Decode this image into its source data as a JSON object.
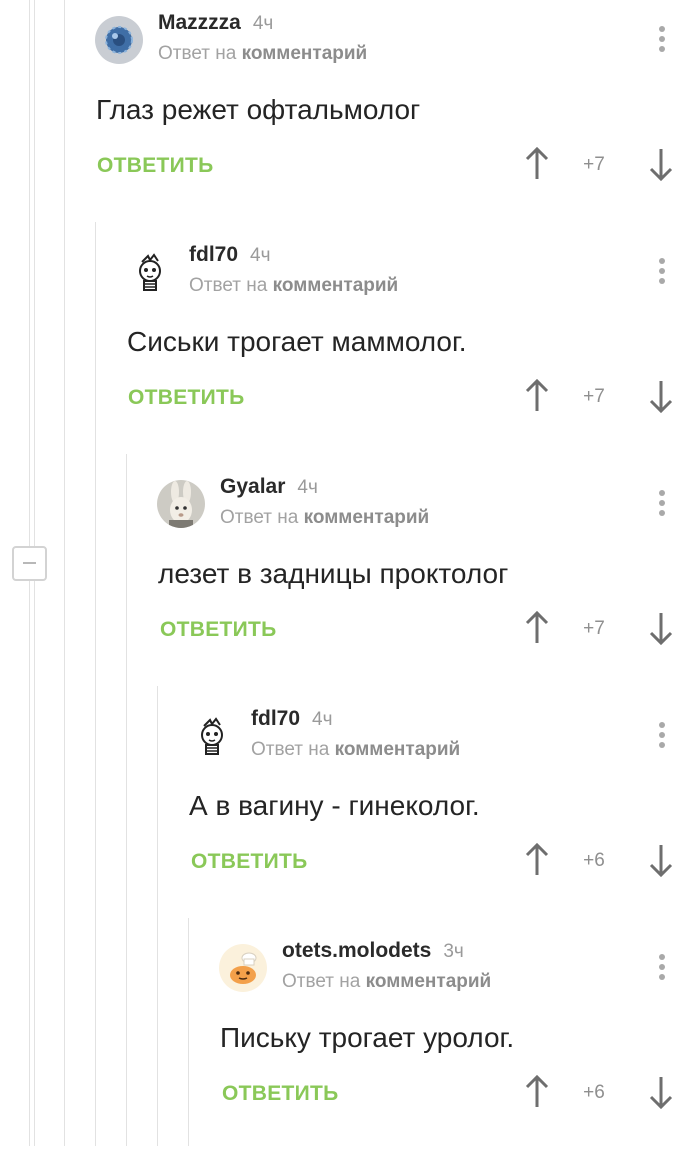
{
  "ui": {
    "reply_label": "ОТВЕТИТЬ",
    "reply_to_prefix": "Ответ на",
    "reply_to_target": "комментарий"
  },
  "comments": [
    {
      "author": "Mazzzza",
      "time": "4ч",
      "text": "Глаз режет офтальмолог",
      "score": "+7",
      "avatar": "blue-sphere-avatar"
    },
    {
      "author": "fdl70",
      "time": "4ч",
      "text": "Сиськи трогает маммолог.",
      "score": "+7",
      "avatar": "lightbulb-avatar"
    },
    {
      "author": "Gyalar",
      "time": "4ч",
      "text": "лезет в задницы проктолог",
      "score": "+7",
      "avatar": "rabbit-avatar"
    },
    {
      "author": "fdl70",
      "time": "4ч",
      "text": "А в вагину - гинеколог.",
      "score": "+6",
      "avatar": "lightbulb-avatar"
    },
    {
      "author": "otets.molodets",
      "time": "3ч",
      "text": "Письку трогает уролог.",
      "score": "+6",
      "avatar": "cartoon-cook-avatar"
    }
  ],
  "colors": {
    "reply_green": "#8ac858",
    "meta_gray": "#9a9a9a",
    "thread_line": "#e2e2e2"
  }
}
